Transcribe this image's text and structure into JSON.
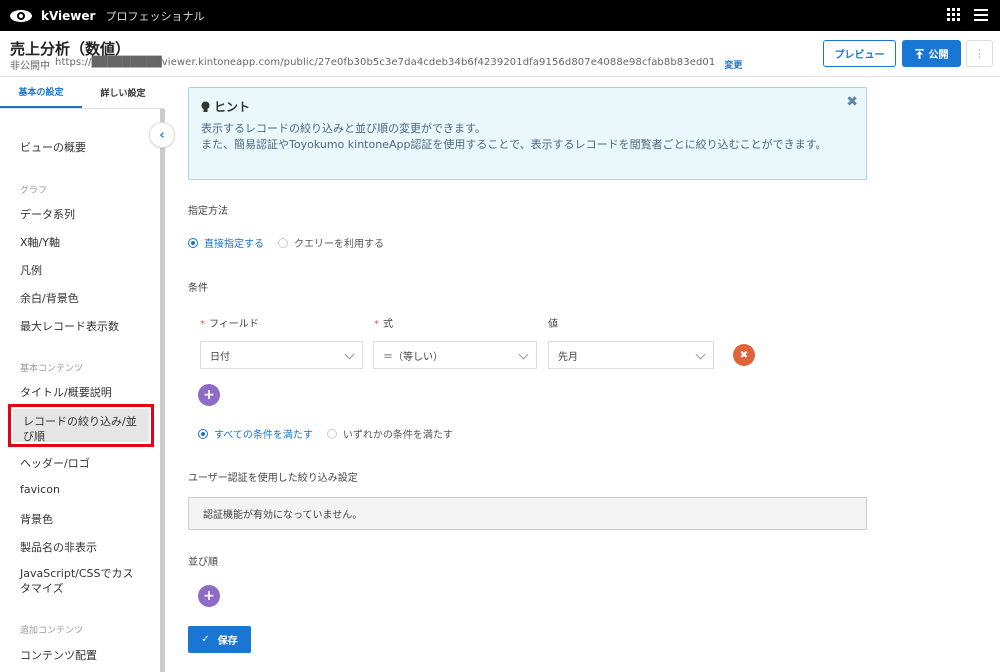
{
  "topbar": {
    "app_name": "kViewer",
    "edition": "プロフェッショナル"
  },
  "header": {
    "title": "売上分析（数値）",
    "status": "非公開中",
    "url": "https://█████████viewer.kintoneapp.com/public/27e0fb30b5c3e7da4cdeb34b6f4239201dfa9156d807e4088e98cfab8b83ed01",
    "change_label": "変更",
    "preview_label": "プレビュー",
    "publish_label": "公開",
    "more_label": "⋮"
  },
  "sidebar": {
    "tabs": [
      {
        "label": "基本の設定",
        "active": true
      },
      {
        "label": "詳しい設定",
        "active": false
      }
    ],
    "collapse_icon": "‹",
    "items": {
      "overview": "ビューの概要",
      "graph_section": "グラフ",
      "data_series": "データ系列",
      "axis": "X軸/Y軸",
      "legend": "凡例",
      "margin_bg": "余白/背景色",
      "max_records": "最大レコード表示数",
      "basic_section": "基本コンテンツ",
      "title_desc": "タイトル/概要説明",
      "filter_sort": "レコードの絞り込み/並び順",
      "header_logo": "ヘッダー/ロゴ",
      "favicon": "favicon",
      "bg_color": "背景色",
      "hide_product": "製品名の非表示",
      "js_css": "JavaScript/CSSでカスタマイズ",
      "extra_section": "追加コンテンツ",
      "content_layout": "コンテンツ配置"
    }
  },
  "hint": {
    "title": "ヒント",
    "line1": "表示するレコードの絞り込みと並び順の変更ができます。",
    "line2": "また、簡易認証やToyokumo kintoneApp認証を使用することで、表示するレコードを閲覧者ごとに絞り込むことができます。",
    "close": "✖"
  },
  "method": {
    "label": "指定方法",
    "options": [
      {
        "label": "直接指定する",
        "selected": true
      },
      {
        "label": "クエリーを利用する",
        "selected": false
      }
    ]
  },
  "conditions": {
    "label": "条件",
    "col_field": "フィールド",
    "col_expr": "式",
    "col_value": "値",
    "required_mark": "*",
    "field_value": "日付",
    "expr_value": "＝（等しい）",
    "value_value": "先月",
    "remove_icon": "✖",
    "add_icon": "+",
    "match_options": [
      {
        "label": "すべての条件を満たす",
        "selected": true
      },
      {
        "label": "いずれかの条件を満たす",
        "selected": false
      }
    ]
  },
  "auth": {
    "label": "ユーザー認証を使用した絞り込み設定",
    "message": "認証機能が有効になっていません。"
  },
  "sort": {
    "label": "並び順",
    "add_icon": "+"
  },
  "save": {
    "label": "保存",
    "icon": "✓"
  }
}
